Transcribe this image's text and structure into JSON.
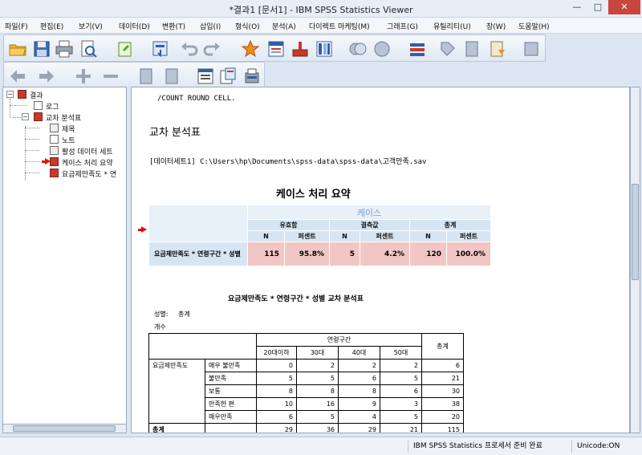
{
  "window": {
    "title": "*결과1 [문서1] - IBM SPSS Statistics Viewer",
    "minimize": "—",
    "maximize": "□",
    "close": "✕"
  },
  "menu": [
    "파일(F)",
    "편집(E)",
    "보기(V)",
    "데이터(D)",
    "변환(T)",
    "삽입(I)",
    "형식(O)",
    "분석(A)",
    "다이렉트 마케팅(M)",
    "그래프(G)",
    "유틸리티(U)",
    "창(W)",
    "도움말(H)"
  ],
  "outline": {
    "items": [
      {
        "label": "결과",
        "level": 0,
        "icon": "output-book-icon"
      },
      {
        "label": "로그",
        "level": 1,
        "icon": "log-icon"
      },
      {
        "label": "교차 분석표",
        "level": 1,
        "icon": "crosstabs-book-icon"
      },
      {
        "label": "제목",
        "level": 2,
        "icon": "title-icon"
      },
      {
        "label": "노트",
        "level": 2,
        "icon": "notes-icon"
      },
      {
        "label": "활성 데이터 세트",
        "level": 2,
        "icon": "dataset-icon"
      },
      {
        "label": "케이스 처리 요약",
        "level": 2,
        "icon": "table-icon"
      },
      {
        "label": "요금제만족도 * 연",
        "level": 2,
        "icon": "table-icon"
      }
    ],
    "expander_open": "−"
  },
  "viewer": {
    "syntax_line": "/COUNT ROUND CELL.",
    "section_title": "교차 분석표",
    "dataset_line": "[데이터세트1] C:\\Users\\hp\\Documents\\spss-data\\spss-data\\고객만족.sav",
    "case_summary": {
      "title": "케이스 처리 요약",
      "group_header": "케이스",
      "subgroups": [
        "유효함",
        "결측값",
        "총계"
      ],
      "col_headers": [
        "N",
        "퍼센트",
        "N",
        "퍼센트",
        "N",
        "퍼센트"
      ],
      "row_label": "요금제만족도 * 연령구간 * 성별",
      "values": [
        "115",
        "95.8%",
        "5",
        "4.2%",
        "120",
        "100.0%"
      ]
    },
    "crosstab": {
      "title": "요금제만족도 * 연령구간 * 성별 교차 분석표",
      "layer_label": "성별:",
      "layer_value": "총계",
      "count_label": "개수",
      "col_group": "연령구간",
      "columns": [
        "20대이하",
        "30대",
        "40대",
        "50대"
      ],
      "total_label": "총계",
      "row_var": "요금제만족도",
      "rows": [
        {
          "label": "매우 불만족",
          "values": [
            "0",
            "2",
            "2",
            "2",
            "6"
          ]
        },
        {
          "label": "불만족",
          "values": [
            "5",
            "5",
            "6",
            "5",
            "21"
          ]
        },
        {
          "label": "보통",
          "values": [
            "8",
            "8",
            "8",
            "6",
            "30"
          ]
        },
        {
          "label": "만족한 편",
          "values": [
            "10",
            "16",
            "9",
            "3",
            "38"
          ]
        },
        {
          "label": "매우만족",
          "values": [
            "6",
            "5",
            "4",
            "5",
            "20"
          ]
        }
      ],
      "total_row": {
        "label": "총계",
        "values": [
          "29",
          "36",
          "29",
          "21",
          "115"
        ]
      }
    }
  },
  "status": {
    "processor": "IBM SPSS Statistics 프로세서 준비 완료",
    "encoding": "Unicode:ON"
  },
  "colors": {
    "accent_red": "#e01010",
    "table_header": "#d6e5f4",
    "table_cell_highlight": "#f3c6c6"
  },
  "icons": {
    "toolbar1": [
      "open-folder-icon",
      "save-icon",
      "print-icon",
      "print-preview-icon",
      "export-icon",
      "recall-dialog-icon",
      "undo-icon",
      "redo-icon",
      "goto-data-icon",
      "goto-case-icon",
      "goto-variable-icon",
      "variables-icon",
      "select-cases-icon",
      "weight-cases-icon",
      "split-file-icon",
      "value-labels-icon",
      "use-sets-icon",
      "designate-window-icon",
      "script-icon"
    ],
    "toolbar2": [
      "back-arrow-icon",
      "forward-arrow-icon",
      "promote-icon",
      "demote-icon",
      "expand-icon",
      "collapse-icon",
      "show-icon",
      "hide-icon",
      "insert-heading-icon",
      "insert-title-icon"
    ]
  }
}
